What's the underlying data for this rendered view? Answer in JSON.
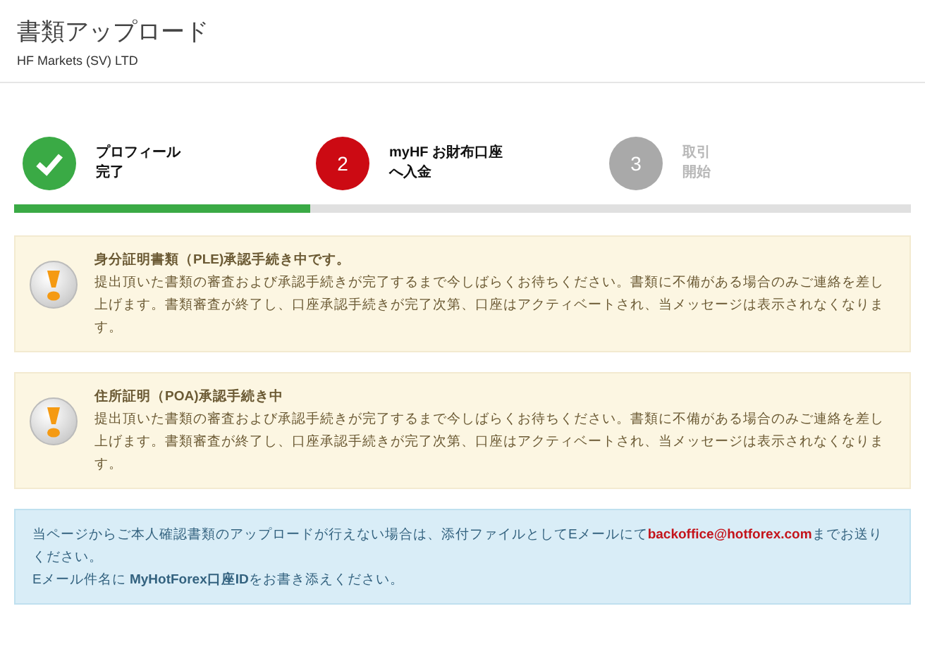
{
  "header": {
    "title": "書類アップロード",
    "subtitle": "HF Markets (SV) LTD"
  },
  "steps": [
    {
      "kind": "done",
      "label_lines": [
        "プロフィール",
        "完了"
      ]
    },
    {
      "kind": "current",
      "number": "2",
      "label_lines": [
        "myHF お財布口座",
        "へ入金"
      ]
    },
    {
      "kind": "pending",
      "number": "3",
      "label_lines": [
        "取引",
        "開始"
      ]
    }
  ],
  "progress": {
    "level": 0.33
  },
  "alerts": [
    {
      "title": "身分証明書類（PLE)承認手続き中です。",
      "body": "提出頂いた書類の審査および承認手続きが完了するまで今しばらくお待ちください。書類に不備がある場合のみご連絡を差し上げます。書類審査が終了し、口座承認手続きが完了次第、口座はアクティベートされ、当メッセージは表示されなくなります。"
    },
    {
      "title": "住所証明（POA)承認手続き中",
      "body": "提出頂いた書類の審査および承認手続きが完了するまで今しばらくお待ちください。書類に不備がある場合のみご連絡を差し上げます。書類審査が終了し、口座承認手続きが完了次第、口座はアクティベートされ、当メッセージは表示されなくなります。"
    }
  ],
  "info": {
    "before": "当ページからご本人確認書類のアップロードが行えない場合は、添付ファイルとしてEメールにて",
    "email": "backoffice@hotforex.com",
    "after": "までお送りください。",
    "line2": "Eメール件名に **MyHotForex口座ID**をお書き添えください。"
  }
}
